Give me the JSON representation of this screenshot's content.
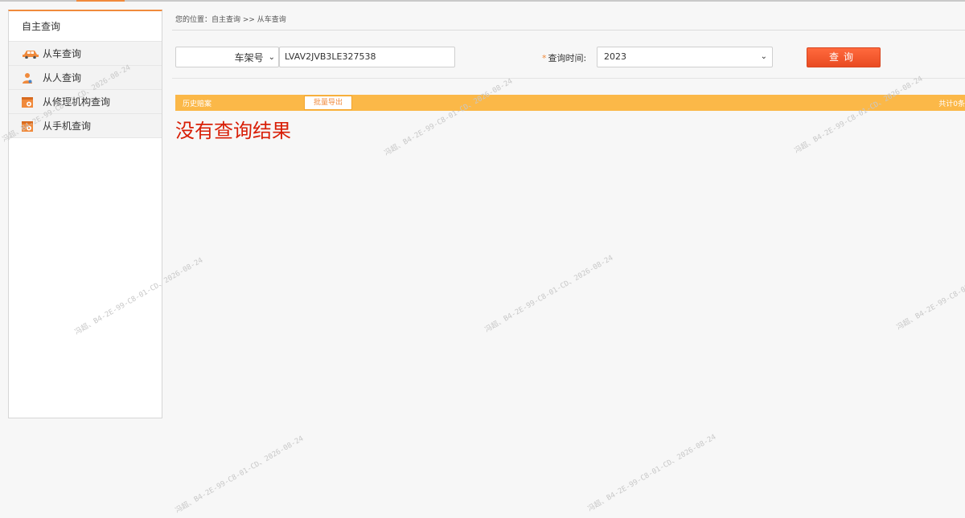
{
  "sidebar": {
    "title": "自主查询",
    "items": [
      {
        "label": "从车查询",
        "icon": "car-icon"
      },
      {
        "label": "从人查询",
        "icon": "person-icon"
      },
      {
        "label": "从修理机构查询",
        "icon": "repair-shop-icon"
      },
      {
        "label": "从手机查询",
        "icon": "phone-icon"
      }
    ]
  },
  "breadcrumb": "您的位置：自主查询 >> 从车查询",
  "search": {
    "type_select": "车架号",
    "vin_value": "LVAV2JVB3LE327538",
    "time_required_mark": "*",
    "time_label": "查询时间:",
    "year_value": "2023",
    "query_button": "查询"
  },
  "results": {
    "history_title": "历史赔案",
    "export_button": "批量导出",
    "total_count": "共计0条",
    "no_result_text": "没有查询结果"
  },
  "watermark": "冯超、B4-2E-99-C8-01-CD、2026-08-24",
  "colors": {
    "accent_orange": "#f08a3c",
    "history_bar": "#fbb848",
    "query_button": "#e94b22",
    "no_result_red": "#d81e06"
  }
}
